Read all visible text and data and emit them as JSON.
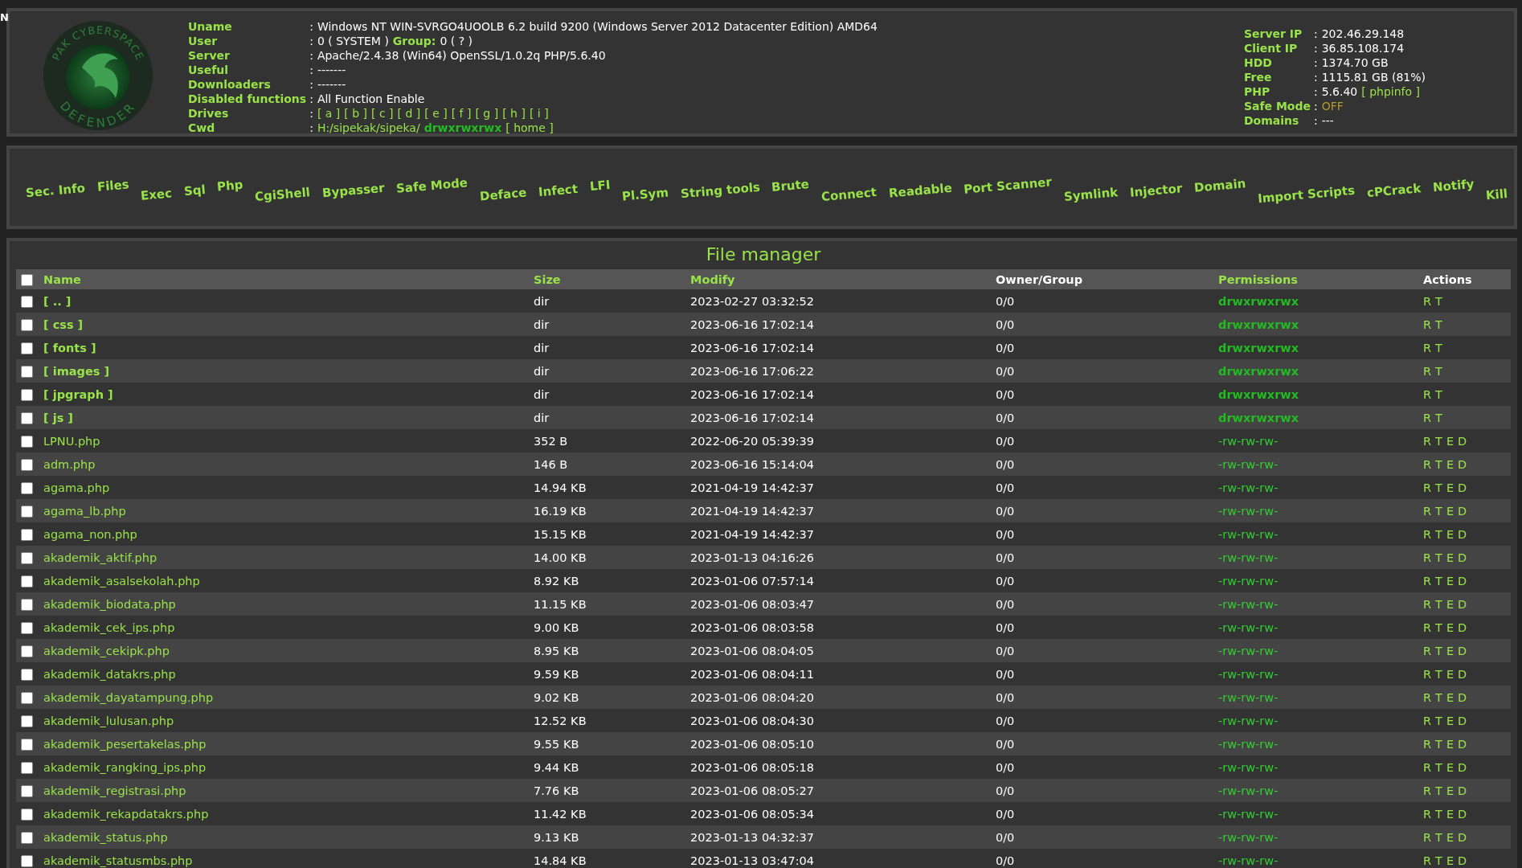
{
  "corner_mark": "N",
  "logo": {
    "top_text": "PAK CYBERSPACE",
    "bottom_text": "DEFENDER"
  },
  "system_info": [
    {
      "label": "Uname",
      "separator": ":",
      "parts": [
        {
          "kind": "text",
          "text": "Windows NT WIN-SVRGO4UOOLB 6.2 build 9200 (Windows Server 2012 Datacenter Edition) AMD64"
        }
      ]
    },
    {
      "label": "User",
      "separator": ":",
      "parts": [
        {
          "kind": "text",
          "text": "0 ( SYSTEM )"
        },
        {
          "kind": "label",
          "text": "Group:"
        },
        {
          "kind": "text",
          "text": "0 ( ? )"
        }
      ]
    },
    {
      "label": "Server",
      "separator": ":",
      "parts": [
        {
          "kind": "text",
          "text": "Apache/2.4.38 (Win64) OpenSSL/1.0.2q PHP/5.6.40"
        }
      ]
    },
    {
      "label": "Useful",
      "separator": ":",
      "parts": [
        {
          "kind": "text",
          "text": "-------"
        }
      ]
    },
    {
      "label": "Downloaders",
      "separator": ":",
      "parts": [
        {
          "kind": "text",
          "text": "-------"
        }
      ]
    },
    {
      "label": "Disabled functions",
      "separator": ":",
      "parts": [
        {
          "kind": "text",
          "text": "All Function Enable"
        }
      ]
    },
    {
      "label": "Drives",
      "separator": ":",
      "parts": [
        {
          "kind": "link",
          "text": "[ a ]"
        },
        {
          "kind": "link",
          "text": "[ b ]"
        },
        {
          "kind": "link",
          "text": "[ c ]"
        },
        {
          "kind": "link",
          "text": "[ d ]"
        },
        {
          "kind": "link",
          "text": "[ e ]"
        },
        {
          "kind": "link",
          "text": "[ f ]"
        },
        {
          "kind": "link",
          "text": "[ g ]"
        },
        {
          "kind": "link",
          "text": "[ h ]"
        },
        {
          "kind": "link",
          "text": "[ i ]"
        }
      ]
    },
    {
      "label": "Cwd",
      "separator": ":",
      "parts": [
        {
          "kind": "link",
          "text": "H:/sipekak/sipeka/"
        },
        {
          "kind": "perm",
          "text": "drwxrwxrwx"
        },
        {
          "kind": "link",
          "text": "[ home ]"
        }
      ]
    }
  ],
  "server_info": [
    {
      "label": "Server IP",
      "separator": ":",
      "parts": [
        {
          "kind": "text",
          "text": "202.46.29.148"
        }
      ]
    },
    {
      "label": "Client IP",
      "separator": ":",
      "parts": [
        {
          "kind": "text",
          "text": "36.85.108.174"
        }
      ]
    },
    {
      "label": "HDD",
      "separator": ":",
      "parts": [
        {
          "kind": "text",
          "text": "1374.70 GB"
        }
      ]
    },
    {
      "label": "Free",
      "separator": ":",
      "parts": [
        {
          "kind": "text",
          "text": "1115.81 GB (81%)"
        }
      ]
    },
    {
      "label": "PHP",
      "separator": ":",
      "parts": [
        {
          "kind": "text",
          "text": "5.6.40"
        },
        {
          "kind": "link",
          "text": "[ phpinfo ]"
        }
      ]
    },
    {
      "label": "Safe Mode",
      "separator": ":",
      "parts": [
        {
          "kind": "off",
          "text": "OFF"
        }
      ]
    },
    {
      "label": "Domains",
      "separator": ":",
      "parts": [
        {
          "kind": "text",
          "text": "---"
        }
      ]
    }
  ],
  "menu": [
    "Sec. Info",
    "Files",
    "Exec",
    "Sql",
    "Php",
    "CgiShell",
    "Bypasser",
    "Safe Mode",
    "Deface",
    "Infect",
    "LFI",
    "Pl.Sym",
    "String tools",
    "Brute",
    "Connect",
    "Readable",
    "Port Scanner",
    "Symlink",
    "Injector",
    "Domain",
    "Import Scripts",
    "cPCrack",
    "Notify",
    "Kill"
  ],
  "file_manager": {
    "title": "File manager",
    "select_all": {
      "checked": false
    },
    "columns": [
      {
        "label": "Name",
        "kind": "link"
      },
      {
        "label": "Size",
        "kind": "link"
      },
      {
        "label": "Modify",
        "kind": "link"
      },
      {
        "label": "Owner/Group",
        "kind": "plain"
      },
      {
        "label": "Permissions",
        "kind": "link"
      },
      {
        "label": "Actions",
        "kind": "plain"
      }
    ],
    "rows": [
      {
        "kind": "dir",
        "checked": false,
        "name": "[ .. ]",
        "size": "dir",
        "modify": "2023-02-27 03:32:52",
        "owner": "0/0",
        "permissions": "drwxrwxrwx",
        "actions": [
          "R",
          "T"
        ]
      },
      {
        "kind": "dir",
        "checked": false,
        "name": "[ css ]",
        "size": "dir",
        "modify": "2023-06-16 17:02:14",
        "owner": "0/0",
        "permissions": "drwxrwxrwx",
        "actions": [
          "R",
          "T"
        ]
      },
      {
        "kind": "dir",
        "checked": false,
        "name": "[ fonts ]",
        "size": "dir",
        "modify": "2023-06-16 17:02:14",
        "owner": "0/0",
        "permissions": "drwxrwxrwx",
        "actions": [
          "R",
          "T"
        ]
      },
      {
        "kind": "dir",
        "checked": false,
        "name": "[ images ]",
        "size": "dir",
        "modify": "2023-06-16 17:06:22",
        "owner": "0/0",
        "permissions": "drwxrwxrwx",
        "actions": [
          "R",
          "T"
        ]
      },
      {
        "kind": "dir",
        "checked": false,
        "name": "[ jpgraph ]",
        "size": "dir",
        "modify": "2023-06-16 17:02:14",
        "owner": "0/0",
        "permissions": "drwxrwxrwx",
        "actions": [
          "R",
          "T"
        ]
      },
      {
        "kind": "dir",
        "checked": false,
        "name": "[ js ]",
        "size": "dir",
        "modify": "2023-06-16 17:02:14",
        "owner": "0/0",
        "permissions": "drwxrwxrwx",
        "actions": [
          "R",
          "T"
        ]
      },
      {
        "kind": "file",
        "checked": false,
        "name": "LPNU.php",
        "size": "352 B",
        "modify": "2022-06-20 05:39:39",
        "owner": "0/0",
        "permissions": "-rw-rw-rw-",
        "actions": [
          "R",
          "T",
          "E",
          "D"
        ]
      },
      {
        "kind": "file",
        "checked": false,
        "name": "adm.php",
        "size": "146 B",
        "modify": "2023-06-16 15:14:04",
        "owner": "0/0",
        "permissions": "-rw-rw-rw-",
        "actions": [
          "R",
          "T",
          "E",
          "D"
        ]
      },
      {
        "kind": "file",
        "checked": false,
        "name": "agama.php",
        "size": "14.94 KB",
        "modify": "2021-04-19 14:42:37",
        "owner": "0/0",
        "permissions": "-rw-rw-rw-",
        "actions": [
          "R",
          "T",
          "E",
          "D"
        ]
      },
      {
        "kind": "file",
        "checked": false,
        "name": "agama_lb.php",
        "size": "16.19 KB",
        "modify": "2021-04-19 14:42:37",
        "owner": "0/0",
        "permissions": "-rw-rw-rw-",
        "actions": [
          "R",
          "T",
          "E",
          "D"
        ]
      },
      {
        "kind": "file",
        "checked": false,
        "name": "agama_non.php",
        "size": "15.15 KB",
        "modify": "2021-04-19 14:42:37",
        "owner": "0/0",
        "permissions": "-rw-rw-rw-",
        "actions": [
          "R",
          "T",
          "E",
          "D"
        ]
      },
      {
        "kind": "file",
        "checked": false,
        "name": "akademik_aktif.php",
        "size": "14.00 KB",
        "modify": "2023-01-13 04:16:26",
        "owner": "0/0",
        "permissions": "-rw-rw-rw-",
        "actions": [
          "R",
          "T",
          "E",
          "D"
        ]
      },
      {
        "kind": "file",
        "checked": false,
        "name": "akademik_asalsekolah.php",
        "size": "8.92 KB",
        "modify": "2023-01-06 07:57:14",
        "owner": "0/0",
        "permissions": "-rw-rw-rw-",
        "actions": [
          "R",
          "T",
          "E",
          "D"
        ]
      },
      {
        "kind": "file",
        "checked": false,
        "name": "akademik_biodata.php",
        "size": "11.15 KB",
        "modify": "2023-01-06 08:03:47",
        "owner": "0/0",
        "permissions": "-rw-rw-rw-",
        "actions": [
          "R",
          "T",
          "E",
          "D"
        ]
      },
      {
        "kind": "file",
        "checked": false,
        "name": "akademik_cek_ips.php",
        "size": "9.00 KB",
        "modify": "2023-01-06 08:03:58",
        "owner": "0/0",
        "permissions": "-rw-rw-rw-",
        "actions": [
          "R",
          "T",
          "E",
          "D"
        ]
      },
      {
        "kind": "file",
        "checked": false,
        "name": "akademik_cekipk.php",
        "size": "8.95 KB",
        "modify": "2023-01-06 08:04:05",
        "owner": "0/0",
        "permissions": "-rw-rw-rw-",
        "actions": [
          "R",
          "T",
          "E",
          "D"
        ]
      },
      {
        "kind": "file",
        "checked": false,
        "name": "akademik_datakrs.php",
        "size": "9.59 KB",
        "modify": "2023-01-06 08:04:11",
        "owner": "0/0",
        "permissions": "-rw-rw-rw-",
        "actions": [
          "R",
          "T",
          "E",
          "D"
        ]
      },
      {
        "kind": "file",
        "checked": false,
        "name": "akademik_dayatampung.php",
        "size": "9.02 KB",
        "modify": "2023-01-06 08:04:20",
        "owner": "0/0",
        "permissions": "-rw-rw-rw-",
        "actions": [
          "R",
          "T",
          "E",
          "D"
        ]
      },
      {
        "kind": "file",
        "checked": false,
        "name": "akademik_lulusan.php",
        "size": "12.52 KB",
        "modify": "2023-01-06 08:04:30",
        "owner": "0/0",
        "permissions": "-rw-rw-rw-",
        "actions": [
          "R",
          "T",
          "E",
          "D"
        ]
      },
      {
        "kind": "file",
        "checked": false,
        "name": "akademik_pesertakelas.php",
        "size": "9.55 KB",
        "modify": "2023-01-06 08:05:10",
        "owner": "0/0",
        "permissions": "-rw-rw-rw-",
        "actions": [
          "R",
          "T",
          "E",
          "D"
        ]
      },
      {
        "kind": "file",
        "checked": false,
        "name": "akademik_rangking_ips.php",
        "size": "9.44 KB",
        "modify": "2023-01-06 08:05:18",
        "owner": "0/0",
        "permissions": "-rw-rw-rw-",
        "actions": [
          "R",
          "T",
          "E",
          "D"
        ]
      },
      {
        "kind": "file",
        "checked": false,
        "name": "akademik_registrasi.php",
        "size": "7.76 KB",
        "modify": "2023-01-06 08:05:27",
        "owner": "0/0",
        "permissions": "-rw-rw-rw-",
        "actions": [
          "R",
          "T",
          "E",
          "D"
        ]
      },
      {
        "kind": "file",
        "checked": false,
        "name": "akademik_rekapdatakrs.php",
        "size": "11.42 KB",
        "modify": "2023-01-06 08:05:34",
        "owner": "0/0",
        "permissions": "-rw-rw-rw-",
        "actions": [
          "R",
          "T",
          "E",
          "D"
        ]
      },
      {
        "kind": "file",
        "checked": false,
        "name": "akademik_status.php",
        "size": "9.13 KB",
        "modify": "2023-01-13 04:32:37",
        "owner": "0/0",
        "permissions": "-rw-rw-rw-",
        "actions": [
          "R",
          "T",
          "E",
          "D"
        ]
      },
      {
        "kind": "file",
        "checked": false,
        "name": "akademik_statusmbs.php",
        "size": "14.84 KB",
        "modify": "2023-01-13 03:47:04",
        "owner": "0/0",
        "permissions": "-rw-rw-rw-",
        "actions": [
          "R",
          "T",
          "E",
          "D"
        ]
      }
    ]
  }
}
